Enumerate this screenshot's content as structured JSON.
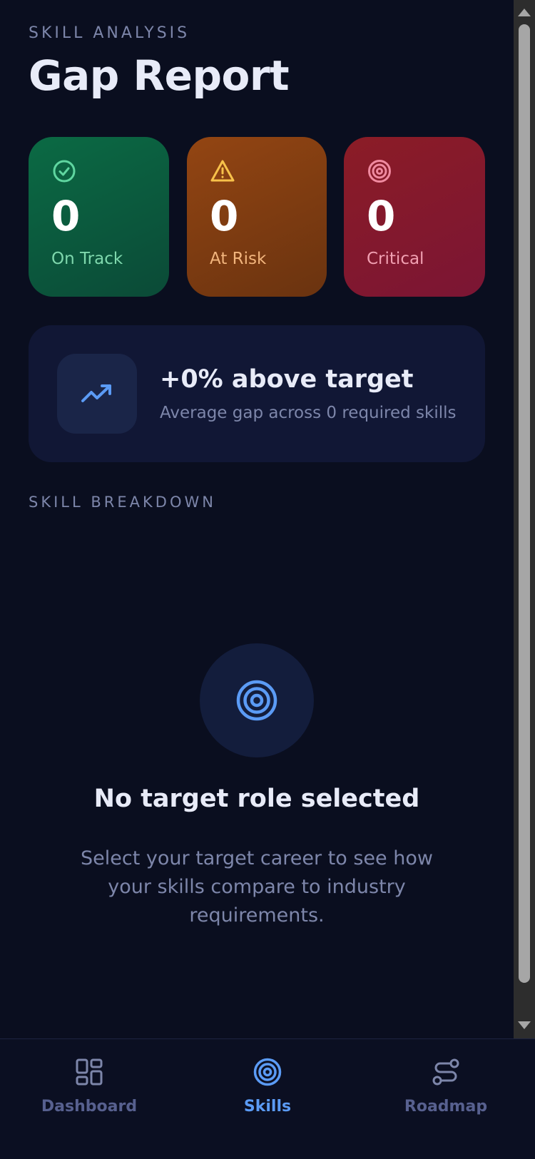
{
  "header": {
    "eyebrow": "SKILL ANALYSIS",
    "title": "Gap Report"
  },
  "stats": [
    {
      "value": "0",
      "label": "On Track",
      "icon": "check-circle-icon",
      "color": "#0b6a44"
    },
    {
      "value": "0",
      "label": "At Risk",
      "icon": "warning-triangle-icon",
      "color": "#934512"
    },
    {
      "value": "0",
      "label": "Critical",
      "icon": "target-icon",
      "color": "#8b1c26"
    }
  ],
  "summary": {
    "headline": "+0% above target",
    "subtext": "Average gap across 0 required skills",
    "icon": "trending-up-icon"
  },
  "breakdown": {
    "section_label": "SKILL BREAKDOWN",
    "empty_icon": "target-icon",
    "empty_title": "No target role selected",
    "empty_text": "Select your target career to see how your skills compare to industry requirements."
  },
  "nav": {
    "items": [
      {
        "label": "Dashboard",
        "icon": "dashboard-grid-icon",
        "active": false
      },
      {
        "label": "Skills",
        "icon": "target-icon",
        "active": true
      },
      {
        "label": "Roadmap",
        "icon": "route-icon",
        "active": false
      }
    ],
    "active_color": "#5b9bf5",
    "inactive_color": "#57608f"
  }
}
